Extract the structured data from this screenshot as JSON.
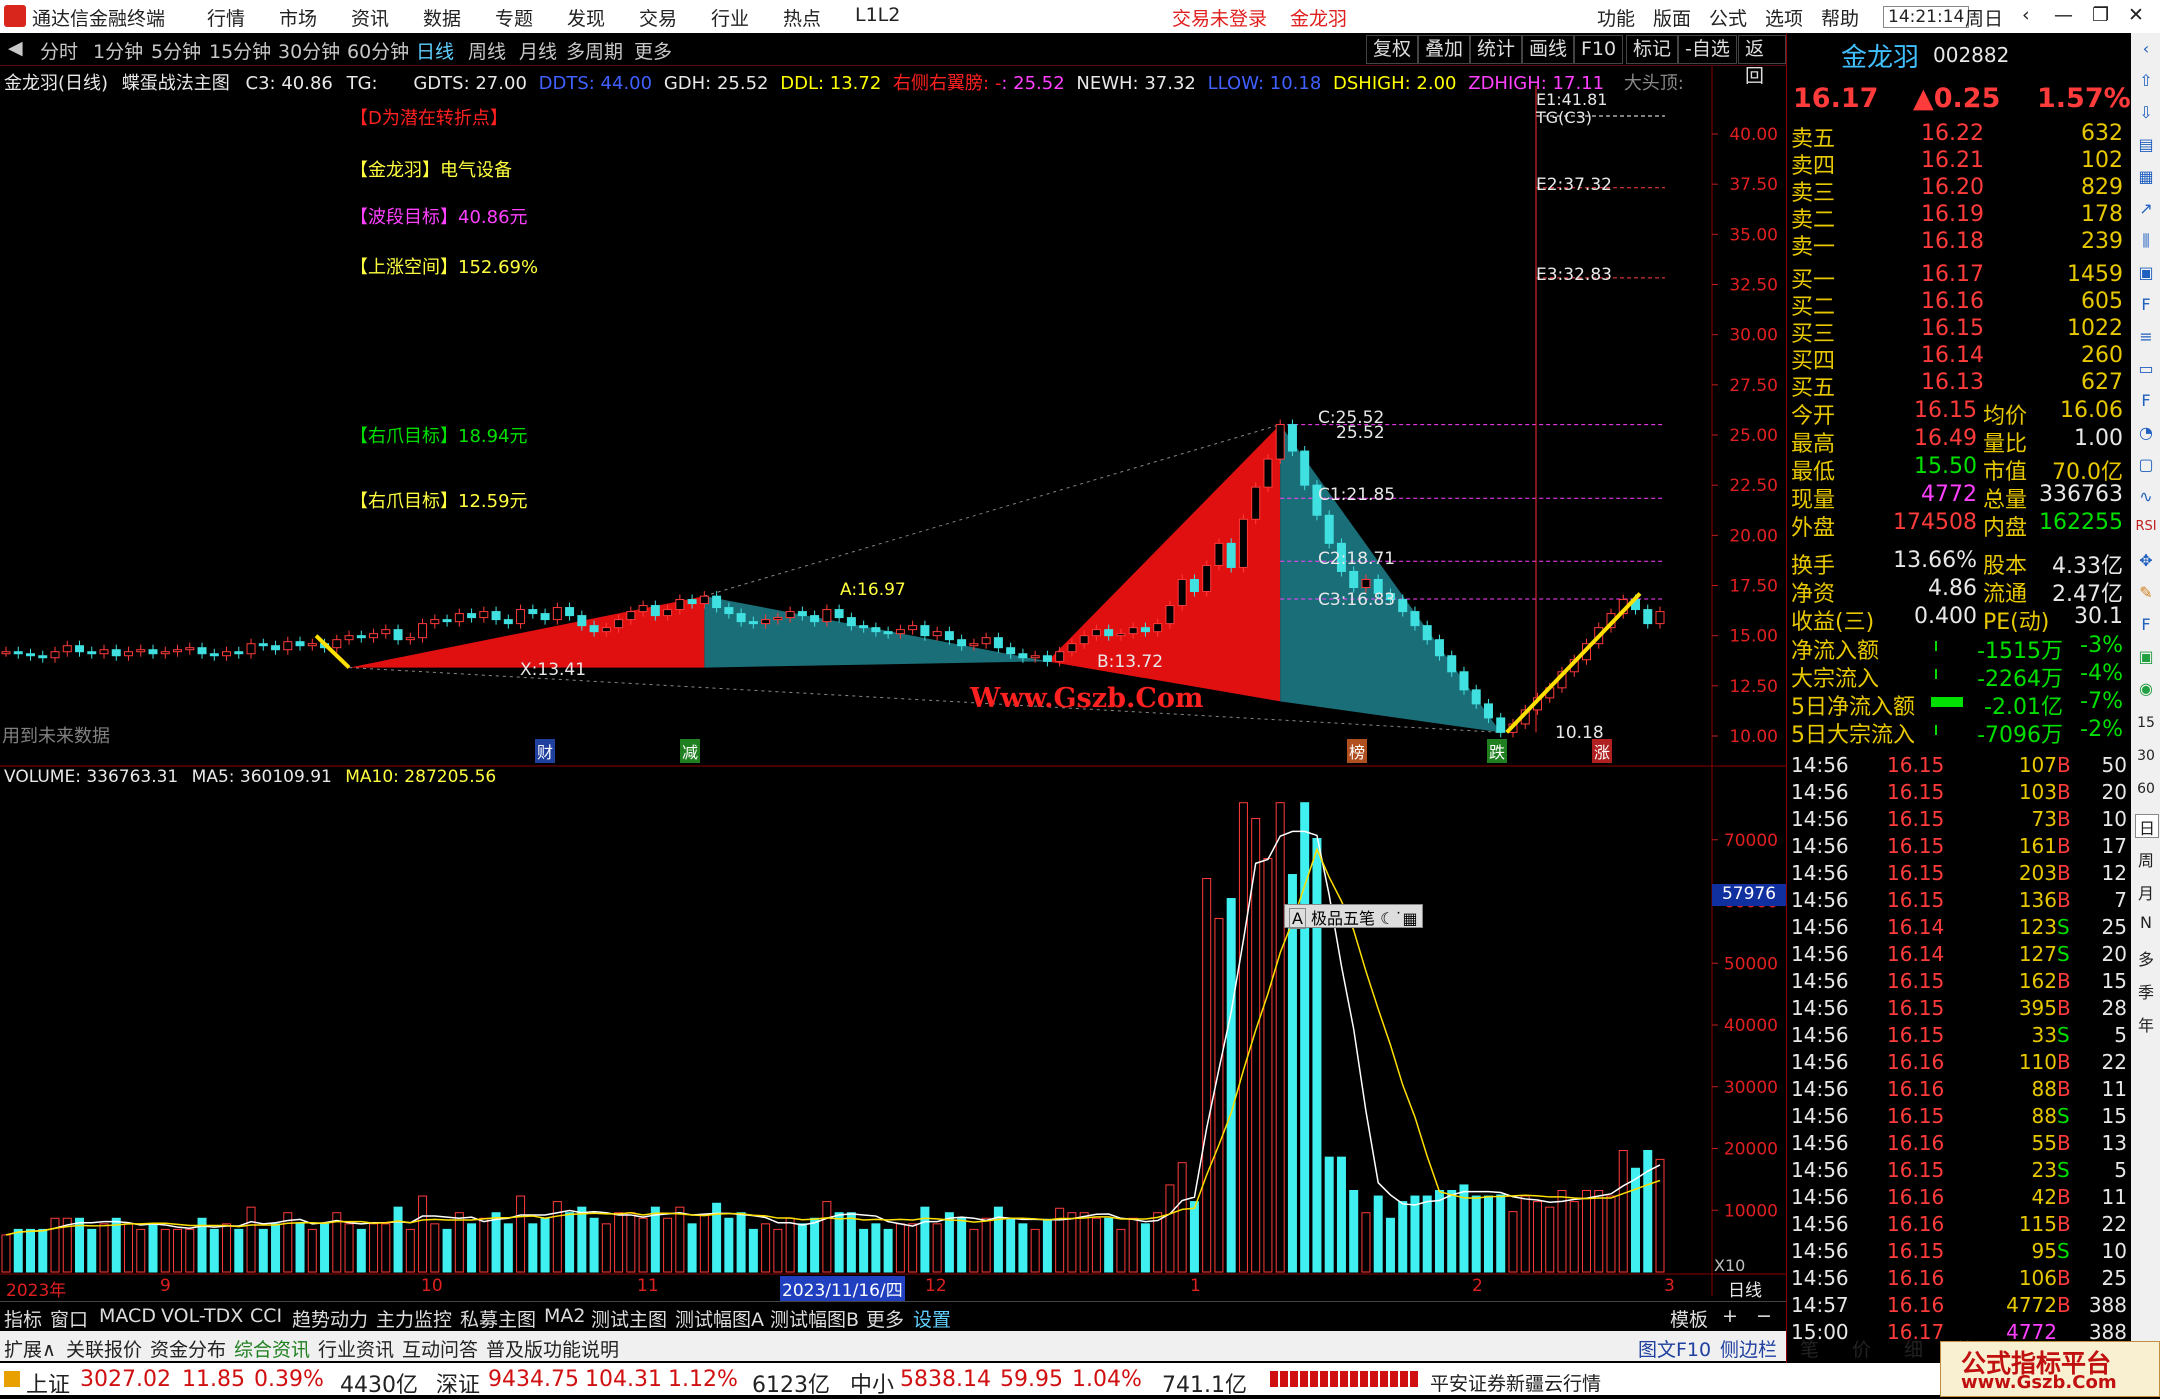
{
  "menubar": {
    "app_title": "通达信金融终端",
    "items": [
      "行情",
      "市场",
      "资讯",
      "数据",
      "专题",
      "发现",
      "交易",
      "行业",
      "热点",
      "L1L2"
    ],
    "login": "交易未登录",
    "stock": "金龙羽",
    "right_items": [
      "功能",
      "版面",
      "公式",
      "选项",
      "帮助"
    ],
    "time": "14:21:14",
    "weekday": "周日"
  },
  "toolbar": {
    "periods": [
      "分时",
      "1分钟",
      "5分钟",
      "15分钟",
      "30分钟",
      "60分钟",
      "日线",
      "周线",
      "月线",
      "多周期",
      "更多"
    ],
    "selected": "日线",
    "right": [
      "复权",
      "叠加",
      "统计",
      "画线",
      "F10",
      "标记",
      "-自选",
      "返回"
    ]
  },
  "chart": {
    "header": {
      "name": "金龙羽(日线)",
      "indicator": "蝶蛋战法主图",
      "c3": "C3: 40.86",
      "tg": "TG:",
      "gdts": "GDTS: 27.00",
      "ddts": "DDTS: 44.00",
      "gdh": "GDH: 25.52",
      "ddl": "DDL: 13.72",
      "yc": "右侧右翼膀: -",
      "yc2": ": 25.52",
      "newh": "NEWH: 37.32",
      "llow": "LLOW: 10.18",
      "dshigh": "DSHIGH: 2.00",
      "zdhigh": "ZDHIGH: 17.11",
      "dtd": "大头顶:"
    },
    "annotations": {
      "d_note": "【D为潜在转折点】",
      "name_tag": "【金龙羽】",
      "industry": "电气设备",
      "wave_label": "【波段目标】",
      "wave_val": "40.86元",
      "up_label": "【上涨空间】",
      "up_val": "152.69%",
      "claw1_label": "【右爪目标】",
      "claw1_val": "18.94元",
      "claw2_label": "【右爪目标】",
      "claw2_val": "12.59元",
      "future": "用到未来数据",
      "watermark": "Www.Gszb.Com"
    },
    "points": {
      "A": "A:16.97",
      "B": "B:13.72",
      "C": "C:25.52",
      "C_b": "25.52",
      "C1": "C1:21.85",
      "C2": "C2:18.71",
      "C3": "C3:16.83",
      "X": "X:13.41",
      "D": "10.18",
      "E1": "E1:41.81",
      "TG": "TG(C3)",
      "E2": "E2:37.32",
      "E3": "E3:32.83"
    },
    "markers": [
      "财",
      "减",
      "榜",
      "跌",
      "涨"
    ],
    "price_axis": [
      "40.00",
      "37.50",
      "35.00",
      "32.50",
      "30.00",
      "27.50",
      "25.00",
      "22.50",
      "20.00",
      "17.50",
      "15.00",
      "12.50",
      "10.00"
    ],
    "volume": {
      "label": "VOLUME: 336763.31",
      "ma5": "MA5: 360109.91",
      "ma10": "MA10: 287205.56",
      "badge": "57976",
      "tool": "极品五笔",
      "xunit": "X10",
      "axis": [
        "70000",
        "60000",
        "50000",
        "40000",
        "30000",
        "20000",
        "10000"
      ]
    },
    "date_axis": [
      "2023年",
      "9",
      "10",
      "11",
      "2023/11/16/四",
      "12",
      "1",
      "2",
      "3"
    ],
    "date_right": "日线"
  },
  "chart_data": {
    "type": "candlestick",
    "title": "金龙羽(日线)",
    "ylim": [
      10,
      40
    ],
    "key_levels": {
      "A": 16.97,
      "B": 13.72,
      "C": 25.52,
      "C1": 21.85,
      "C2": 18.71,
      "C3": 16.83,
      "X": 13.41,
      "D": 10.18,
      "E2": 37.32,
      "E3": 32.83
    },
    "close_path": [
      14.2,
      14.1,
      14.0,
      13.9,
      14.2,
      14.5,
      14.2,
      14.1,
      14.3,
      14.0,
      14.2,
      14.3,
      14.1,
      14.2,
      14.3,
      14.4,
      14.1,
      14.0,
      14.2,
      14.1,
      14.6,
      14.5,
      14.3,
      14.7,
      14.5,
      14.6,
      14.4,
      14.8,
      15.0,
      14.9,
      15.1,
      15.3,
      14.8,
      14.9,
      15.6,
      15.8,
      15.7,
      16.1,
      15.9,
      16.2,
      15.8,
      15.6,
      16.3,
      16.1,
      15.8,
      16.4,
      16.0,
      15.5,
      15.2,
      15.4,
      15.8,
      16.2,
      16.5,
      16.0,
      16.3,
      16.8,
      16.6,
      16.97,
      16.4,
      16.1,
      15.7,
      15.6,
      15.8,
      15.9,
      16.2,
      16.0,
      15.7,
      16.3,
      15.9,
      15.5,
      15.4,
      15.2,
      15.1,
      15.3,
      15.5,
      15.0,
      15.2,
      14.8,
      14.5,
      14.6,
      14.9,
      14.4,
      14.1,
      13.9,
      14.0,
      13.72,
      14.2,
      14.6,
      15.0,
      15.3,
      15.0,
      15.1,
      15.4,
      15.2,
      15.6,
      16.5,
      17.8,
      17.2,
      18.5,
      19.6,
      18.4,
      20.8,
      22.4,
      23.8,
      25.52,
      24.2,
      22.5,
      21.0,
      19.6,
      18.2,
      17.4,
      17.8,
      17.1,
      16.8,
      16.2,
      15.5,
      14.8,
      14.0,
      13.2,
      12.3,
      11.6,
      10.9,
      10.18,
      10.6,
      11.3,
      11.9,
      12.4,
      13.2,
      13.8,
      14.6,
      15.4,
      16.1,
      16.8,
      16.3,
      15.6,
      16.2
    ]
  },
  "right_panel": {
    "name": "金龙羽",
    "code": "002882",
    "price": "16.17",
    "change": "▲0.25",
    "pct": "1.57%",
    "asks": [
      [
        "卖五",
        "16.22",
        "632"
      ],
      [
        "卖四",
        "16.21",
        "102"
      ],
      [
        "卖三",
        "16.20",
        "829"
      ],
      [
        "卖二",
        "16.19",
        "178"
      ],
      [
        "卖一",
        "16.18",
        "239"
      ]
    ],
    "bids": [
      [
        "买一",
        "16.17",
        "1459"
      ],
      [
        "买二",
        "16.16",
        "605"
      ],
      [
        "买三",
        "16.15",
        "1022"
      ],
      [
        "买四",
        "16.14",
        "260"
      ],
      [
        "买五",
        "16.13",
        "627"
      ]
    ],
    "stats": [
      [
        "今开",
        "16.15",
        "均价",
        "16.06"
      ],
      [
        "最高",
        "16.49",
        "量比",
        "1.00"
      ],
      [
        "最低",
        "15.50",
        "市值",
        "70.0亿"
      ],
      [
        "现量",
        "4772",
        "总量",
        "336763"
      ],
      [
        "外盘",
        "174508",
        "内盘",
        "162255"
      ]
    ],
    "stats2": [
      [
        "换手",
        "13.66%",
        "股本",
        "4.33亿"
      ],
      [
        "净资",
        "4.86",
        "流通",
        "2.47亿"
      ],
      [
        "收益(三)",
        "0.400",
        "PE(动)",
        "30.1"
      ]
    ],
    "flows": [
      [
        "净流入额",
        "-1515万",
        "-3%"
      ],
      [
        "大宗流入",
        "-2264万",
        "-4%"
      ],
      [
        "5日净流入额",
        "-2.01亿",
        "-7%"
      ],
      [
        "5日大宗流入",
        "-7096万",
        "-2%"
      ]
    ],
    "ticks": [
      [
        "14:56",
        "16.15",
        "107",
        "B",
        "50"
      ],
      [
        "14:56",
        "16.15",
        "103",
        "B",
        "20"
      ],
      [
        "14:56",
        "16.15",
        "73",
        "B",
        "10"
      ],
      [
        "14:56",
        "16.15",
        "161",
        "B",
        "17"
      ],
      [
        "14:56",
        "16.15",
        "203",
        "B",
        "12"
      ],
      [
        "14:56",
        "16.15",
        "136",
        "B",
        "7"
      ],
      [
        "14:56",
        "16.14",
        "123",
        "S",
        "25"
      ],
      [
        "14:56",
        "16.14",
        "127",
        "S",
        "20"
      ],
      [
        "14:56",
        "16.15",
        "162",
        "B",
        "15"
      ],
      [
        "14:56",
        "16.15",
        "395",
        "B",
        "28"
      ],
      [
        "14:56",
        "16.15",
        "33",
        "S",
        "5"
      ],
      [
        "14:56",
        "16.16",
        "110",
        "B",
        "22"
      ],
      [
        "14:56",
        "16.16",
        "88",
        "B",
        "11"
      ],
      [
        "14:56",
        "16.15",
        "88",
        "S",
        "15"
      ],
      [
        "14:56",
        "16.16",
        "55",
        "B",
        "13"
      ],
      [
        "14:56",
        "16.15",
        "23",
        "S",
        "5"
      ],
      [
        "14:56",
        "16.16",
        "42",
        "B",
        "11"
      ],
      [
        "14:56",
        "16.16",
        "115",
        "B",
        "22"
      ],
      [
        "14:56",
        "16.15",
        "95",
        "S",
        "10"
      ],
      [
        "14:56",
        "16.16",
        "106",
        "B",
        "25"
      ],
      [
        "14:57",
        "16.16",
        "4772",
        "B",
        "388"
      ],
      [
        "15:00",
        "16.17",
        "4772",
        "",
        "388"
      ]
    ]
  },
  "sidebar": {
    "items": [
      "RSI",
      "15",
      "30",
      "60",
      "日",
      "周",
      "月",
      "N",
      "多",
      "季",
      "年"
    ]
  },
  "bottom": {
    "row1": [
      "指标",
      "窗口",
      "MACD",
      "VOL-TDX",
      "CCI",
      "趋势动力",
      "主力监控",
      "私募主图",
      "MA2",
      "测试主图",
      "测试幅图A",
      "测试幅图B",
      "更多",
      "设置"
    ],
    "row1_right": [
      "模板",
      "+",
      "−"
    ],
    "row2": [
      "扩展∧",
      "关联报价",
      "资金分布",
      "综合资讯",
      "行业资讯",
      "互动问答",
      "普及版功能说明"
    ],
    "row2_right": [
      "图文F10",
      "侧边栏《",
      "笔",
      "价",
      "细",
      "势"
    ],
    "index": [
      [
        "上证",
        "3027.02",
        "11.85",
        "0.39%",
        "4430亿"
      ],
      [
        "深证",
        "9434.75",
        "104.31",
        "1.12%",
        "6123亿"
      ],
      [
        "中小",
        "5838.14",
        "59.95",
        "1.04%",
        "741.1亿"
      ]
    ],
    "broker": "平安证券新疆云行情",
    "brand": "公式指标平台",
    "brand_url": "www.Gszb.Com"
  }
}
